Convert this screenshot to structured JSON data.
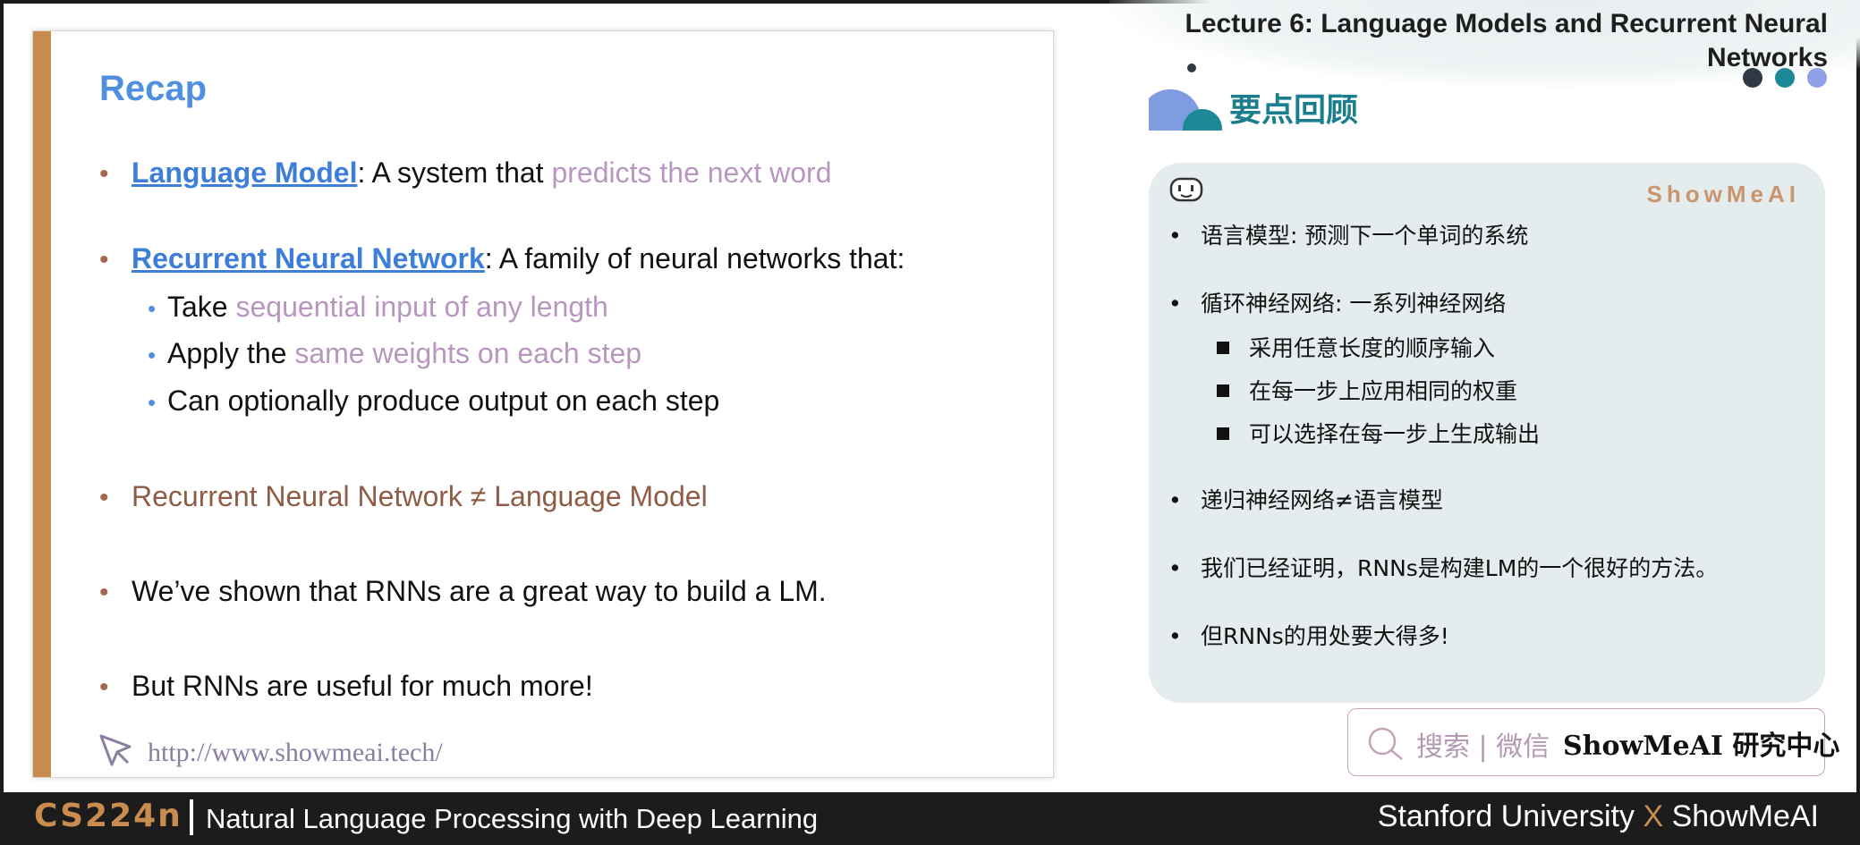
{
  "lecture_title_line1": "Lecture 6:  Language Models and Recurrent Neural",
  "lecture_title_line2": "Networks",
  "section_title": "要点回顾",
  "slide": {
    "title": "Recap",
    "b1_term": "Language Model",
    "b1_sep": ": A system that ",
    "b1_hl": "predicts the next word",
    "b2_term": "Recurrent Neural Network",
    "b2_rest": ": A family of neural networks that:",
    "s1_a": "Take ",
    "s1_hl": "sequential input of any length",
    "s2_a": "Apply the ",
    "s2_hl": "same weights on each step",
    "s3": "Can optionally produce output on each step",
    "b3": "Recurrent Neural Network ≠ Language Model",
    "b4": "We’ve shown that RNNs are a great way to build a LM.",
    "b5": "But RNNs are useful for much more!",
    "url": "http://www.showmeai.tech/"
  },
  "panel": {
    "brand": "ShowMeAI",
    "items": [
      "语言模型: 预测下一个单词的系统",
      "循环神经网络: 一系列神经网络",
      "采用任意长度的顺序输入",
      "在每一步上应用相同的权重",
      "可以选择在每一步上生成输出",
      "递归神经网络≠语言模型",
      "我们已经证明，RNNs是构建LM的一个很好的方法。",
      "但RNNs的用处要大得多!"
    ]
  },
  "search": {
    "hint": "搜索 | 微信",
    "brand": "ShowMeAI 研究中心"
  },
  "footer": {
    "course": "CS224n",
    "course_name": "Natural Language Processing with Deep Learning",
    "right_a": "Stanford University ",
    "right_x": "X",
    "right_b": " ShowMeAI"
  },
  "colors": {
    "accent_brown": "#c98c4f",
    "title_blue": "#4e8fe0",
    "teal": "#1b7e8e",
    "highlight_pink": "#b896bf"
  }
}
